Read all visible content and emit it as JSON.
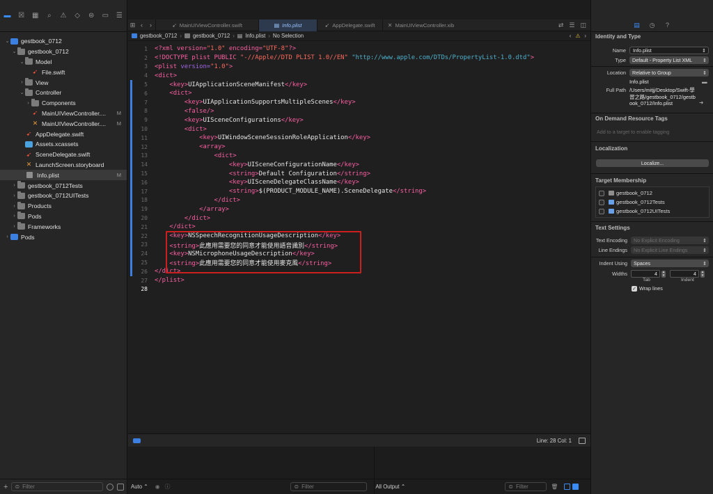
{
  "navigator": {
    "items": [
      {
        "label": "gestbook_0712",
        "badge": ""
      },
      {
        "label": "gestbook_0712",
        "badge": ""
      },
      {
        "label": "Model",
        "badge": ""
      },
      {
        "label": "File.swift",
        "badge": ""
      },
      {
        "label": "View",
        "badge": ""
      },
      {
        "label": "Controller",
        "badge": ""
      },
      {
        "label": "Components",
        "badge": ""
      },
      {
        "label": "MainUIViewController....",
        "badge": "M"
      },
      {
        "label": "MainUIViewController....",
        "badge": "M"
      },
      {
        "label": "AppDelegate.swift",
        "badge": ""
      },
      {
        "label": "Assets.xcassets",
        "badge": ""
      },
      {
        "label": "SceneDelegate.swift",
        "badge": ""
      },
      {
        "label": "LaunchScreen.storyboard",
        "badge": ""
      },
      {
        "label": "Info.plist",
        "badge": "M"
      },
      {
        "label": "gestbook_0712Tests",
        "badge": ""
      },
      {
        "label": "gestbook_0712UITests",
        "badge": ""
      },
      {
        "label": "Products",
        "badge": ""
      },
      {
        "label": "Pods",
        "badge": ""
      },
      {
        "label": "Frameworks",
        "badge": ""
      },
      {
        "label": "Pods",
        "badge": ""
      }
    ],
    "filter_placeholder": "Filter"
  },
  "tabs": [
    {
      "label": "MainUIViewController.swift"
    },
    {
      "label": "Info.plist"
    },
    {
      "label": "AppDelegate.swift"
    },
    {
      "label": "MainUIViewController.xib"
    }
  ],
  "breadcrumb": {
    "items": [
      "gestbook_0712",
      "gestbook_0712",
      "Info.plist",
      "No Selection"
    ]
  },
  "code_lines": [
    "1",
    "2",
    "3",
    "4",
    "5",
    "6",
    "7",
    "8",
    "9",
    "10",
    "11",
    "12",
    "13",
    "14",
    "15",
    "16",
    "17",
    "18",
    "19",
    "20",
    "21",
    "22",
    "23",
    "24",
    "25",
    "26",
    "27",
    "28"
  ],
  "code": {
    "l1_a": "<?xml version=",
    "l1_b": "\"1.0\"",
    "l1_c": " encoding=",
    "l1_d": "\"UTF-8\"",
    "l1_e": "?>",
    "l2_a": "<!DOCTYPE plist PUBLIC ",
    "l2_b": "\"-//Apple//DTD PLIST 1.0//EN\"",
    "l2_c": " ",
    "l2_d": "\"http://www.apple.com/DTDs/PropertyList-1.0.dtd\"",
    "l2_e": ">",
    "l3_a": "<plist ",
    "l3_b": "version=",
    "l3_c": "\"1.0\"",
    "l3_d": ">",
    "l4": "<dict>",
    "l5_k": "UIApplicationSceneManifest",
    "l6": "<dict>",
    "l7_k": "UIApplicationSupportsMultipleScenes",
    "l8": "<false/>",
    "l9_k": "UISceneConfigurations",
    "l10": "<dict>",
    "l11_k": "UIWindowSceneSessionRoleApplication",
    "l12": "<array>",
    "l13": "<dict>",
    "l14_k": "UISceneConfigurationName",
    "l15_s": "Default Configuration",
    "l16_k": "UISceneDelegateClassName",
    "l17_s": "$(PRODUCT_MODULE_NAME).SceneDelegate",
    "l18": "</dict>",
    "l19": "</array>",
    "l20": "</dict>",
    "l21": "</dict>",
    "l22_k": "NSSpeechRecognitionUsageDescription",
    "l23_s": "此應用需要您的同意才能使用語音識別",
    "l24_k": "NSMicrophoneUsageDescription",
    "l25_s": "此應用需要您的同意才能使用麥克風",
    "l26": "</dict>",
    "l27": "</plist>",
    "key_open": "<key>",
    "key_close": "</key>",
    "str_open": "<string>",
    "str_close": "</string>"
  },
  "status": {
    "position": "Line: 28  Col: 1"
  },
  "debug": {
    "auto_label": "Auto ⌃",
    "filter_placeholder": "Filter",
    "output_label": "All Output ⌃",
    "filter2_placeholder": "Filter"
  },
  "inspector": {
    "identity_title": "Identity and Type",
    "name_label": "Name",
    "name_value": "Info.plist",
    "type_label": "Type",
    "type_value": "Default - Property List XML",
    "location_label": "Location",
    "location_value": "Relative to Group",
    "location_file": "Info.plist",
    "fullpath_label": "Full Path",
    "fullpath_value": "/Users/mitjj/Desktop/Swift-學習之路/gestbook_0712/gestbook_0712/Info.plist",
    "odr_title": "On Demand Resource Tags",
    "odr_placeholder": "Add to a target to enable tagging",
    "localization_title": "Localization",
    "localize_button": "Localize...",
    "target_title": "Target Membership",
    "targets": [
      "gestbook_0712",
      "gestbook_0712Tests",
      "gestbook_0712UITests"
    ],
    "text_settings_title": "Text Settings",
    "encoding_label": "Text Encoding",
    "encoding_value": "No Explicit Encoding",
    "line_endings_label": "Line Endings",
    "line_endings_value": "No Explicit Line Endings",
    "indent_label": "Indent Using",
    "indent_value": "Spaces",
    "widths_label": "Widths",
    "tab_width": "4",
    "indent_width": "4",
    "tab_caption": "Tab",
    "indent_caption": "Indent",
    "wrap_label": "Wrap lines"
  }
}
